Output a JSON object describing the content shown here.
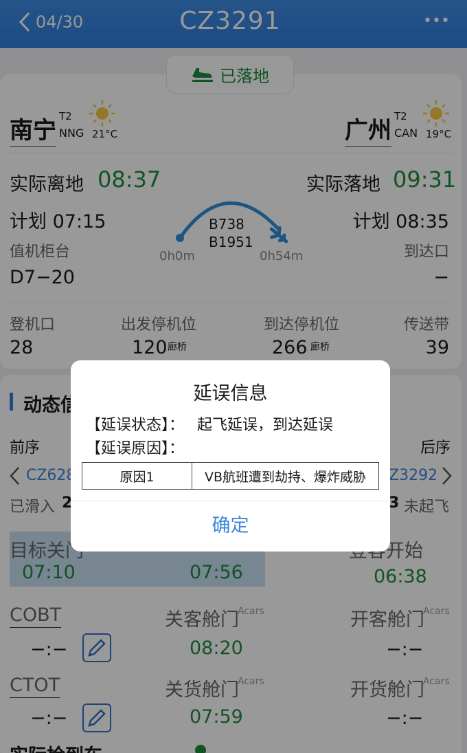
{
  "header": {
    "back_label": "04/30",
    "flight": "CZ3291",
    "more": "•••"
  },
  "status": {
    "label": "已落地"
  },
  "origin": {
    "city": "南宁",
    "terminal": "T2",
    "code": "NNG",
    "temp": "21°C"
  },
  "dest": {
    "city": "广州",
    "terminal": "T2",
    "code": "CAN",
    "temp": "19°C"
  },
  "departure": {
    "label": "实际离地",
    "time": "08:37",
    "plan": "计划 07:15",
    "counter_label": "值机柜台",
    "counter": "D7−20"
  },
  "arrival": {
    "label": "实际落地",
    "time": "09:31",
    "plan": "计划 08:35",
    "exit_label": "到达口",
    "exit": "−"
  },
  "aircraft": {
    "type": "B738",
    "reg": "B1951",
    "elapsed": "0h0m",
    "total": "0h54m",
    "progress": 1.0
  },
  "gates": {
    "gate_label": "登机口",
    "gate": "28",
    "dep_stand_label": "出发停机位",
    "dep_stand": "120",
    "dep_stand_tag": "廊桥",
    "arr_stand_label": "到达停机位",
    "arr_stand": "266",
    "arr_stand_tag": "廊桥",
    "belt_label": "传送带",
    "belt": "39"
  },
  "dynamic": {
    "title": "动态信",
    "prev_label": "前序",
    "next_label": "后序",
    "prev_flight": "CZ628",
    "next_flight": "Z3292",
    "prev_status": "已滑入",
    "prev_status_num": "2",
    "next_status_num": "3",
    "next_status": "未起飞",
    "target_close_label": "目标关门",
    "target_close": "07:10",
    "mid_time": "07:56",
    "board_label": "登客开始",
    "board": "06:38",
    "cobt_label": "COBT",
    "cobt": "−:−",
    "close_pax_label": "关客舱门",
    "close_pax": "08:20",
    "open_pax_label": "开客舱门",
    "open_pax": "−:−",
    "ctot_label": "CTOT",
    "ctot": "−:−",
    "close_cargo_label": "关货舱门",
    "close_cargo": "07:59",
    "open_cargo_label": "开货舱门",
    "open_cargo": "−:−",
    "acars": "Acars",
    "bottom_label": "实际检到车"
  },
  "dialog": {
    "title": "延误信息",
    "status_label": "【延误状态】：",
    "status_value": "起飞延误，到达延误",
    "reason_label": "【延误原因】：",
    "reason_key": "原因1",
    "reason_value": "VB航班遭到劫持、爆炸威胁",
    "confirm": "确定"
  },
  "colors": {
    "header_blue": "#2f7fdc",
    "green": "#1f8a3c",
    "link_blue": "#3a86d8"
  }
}
